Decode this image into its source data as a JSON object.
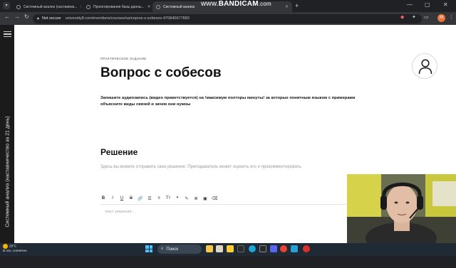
{
  "browser": {
    "tabs": [
      {
        "title": "Системный анализ (настаивни...",
        "active": false
      },
      {
        "title": "Проектирование базы данны...",
        "active": false
      },
      {
        "title": "Системный анализ",
        "active": true
      }
    ],
    "new_tab": "+",
    "recorder_watermark": {
      "www": "www.",
      "brand": "BANDICAM",
      "domain": ".com"
    },
    "security_label": "Not secure",
    "url": "university8.com/members/courses/sa/vopros-s-sobesov-970840677883",
    "profile_initial": "M",
    "window_controls": [
      "—",
      "▢",
      "✕"
    ]
  },
  "sidebar": {
    "course_title": "Системный анализ (наставничество за 21 день)"
  },
  "page": {
    "eyebrow": "ПРАКТИЧЕСКОЕ ЗАДАНИЕ",
    "title": "Вопрос с собесов",
    "task": "Запишите аудиозапись (видео приветствуется) на !максимум полторы минуты! за которые понятным языком с примерами объясните виды связей и зачем они нужны",
    "solution_heading": "Решение",
    "solution_hint": "Здесь вы можете отправить свое решение. Преподаватель может оценить его и прокомментировать.",
    "editor_placeholder": "текст решения..."
  },
  "editor_toolbar": [
    {
      "label": "B",
      "name": "bold-button"
    },
    {
      "label": "I",
      "name": "italic-button"
    },
    {
      "label": "U",
      "name": "underline-button"
    },
    {
      "label": "S",
      "name": "strikethrough-button"
    },
    {
      "label": "🔗",
      "name": "link-button"
    },
    {
      "label": "☰",
      "name": "ordered-list-button"
    },
    {
      "label": "≡",
      "name": "bullet-list-button"
    },
    {
      "label": "Tт",
      "name": "text-size-button"
    },
    {
      "label": "❞",
      "name": "quote-button"
    },
    {
      "label": "✎",
      "name": "highlight-button"
    },
    {
      "label": "≣",
      "name": "align-button"
    },
    {
      "label": "▣",
      "name": "image-button"
    },
    {
      "label": "⌫",
      "name": "clear-format-button"
    }
  ],
  "taskbar": {
    "temperature": "28°C",
    "weather": "В осн. солнечно",
    "search_label": "Поиск"
  },
  "colors": {
    "accent_windows": "#4cc2ff",
    "profile_bg": "#e8743b"
  }
}
